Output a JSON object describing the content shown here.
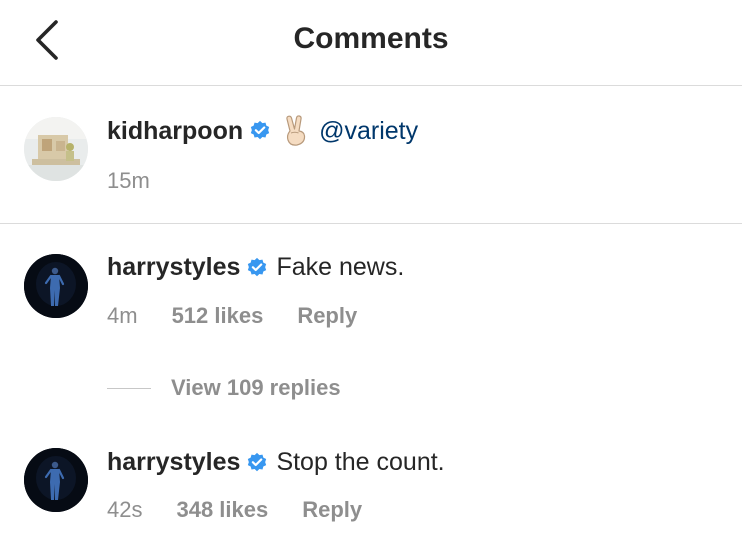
{
  "header": {
    "title": "Comments",
    "back_icon": "chevron-left-icon"
  },
  "caption": {
    "username": "kidharpoon",
    "verified": true,
    "emoji": "victory-hand",
    "mention": "@variety",
    "time": "15m"
  },
  "comments": [
    {
      "username": "harrystyles",
      "verified": true,
      "text": "Fake news.",
      "time": "4m",
      "likes": "512 likes",
      "reply_label": "Reply",
      "view_replies": "View 109 replies"
    },
    {
      "username": "harrystyles",
      "verified": true,
      "text": "Stop the count.",
      "time": "42s",
      "likes": "348 likes",
      "reply_label": "Reply"
    }
  ],
  "colors": {
    "verified_blue": "#3897f0",
    "mention": "#00376b",
    "meta_gray": "#8e8e8e",
    "divider": "#dbdbdb"
  }
}
